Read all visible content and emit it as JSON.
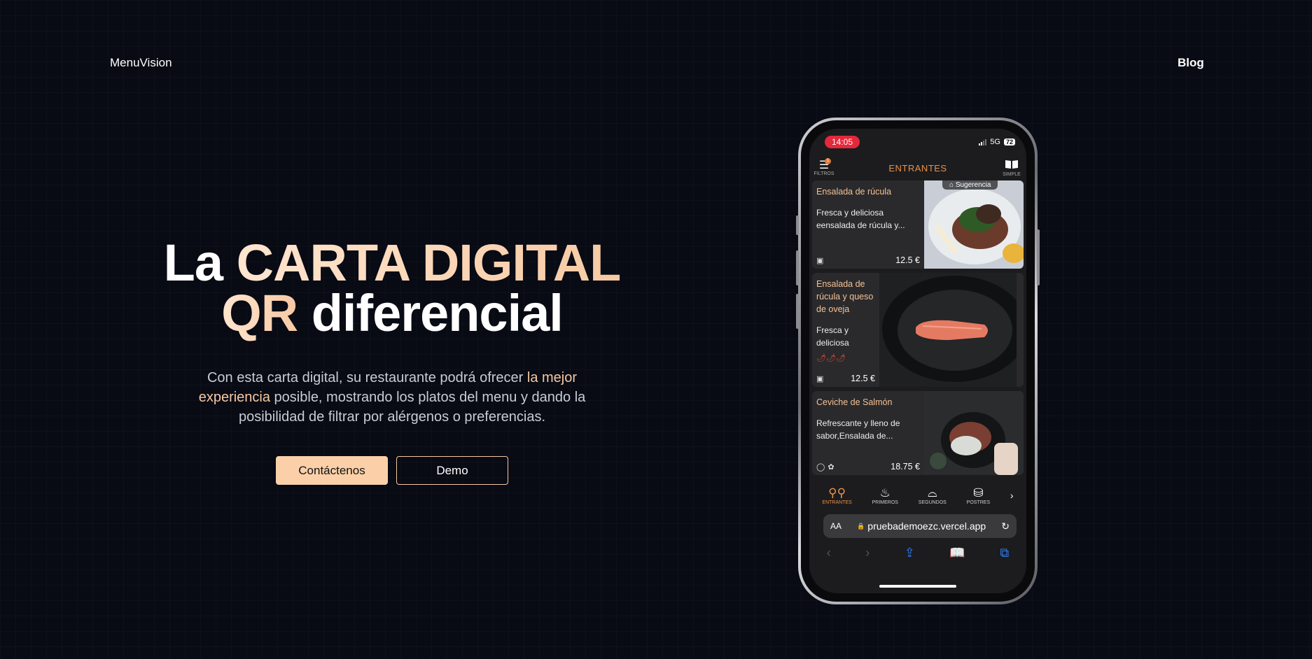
{
  "nav": {
    "brand": "MenuVision",
    "blog": "Blog"
  },
  "hero": {
    "title_1": "La ",
    "title_accent_1": "CARTA DIGITAL",
    "title_accent_2": "QR",
    "title_2": " diferencial",
    "desc_1": "Con esta carta digital, su restaurante podrá ofrecer ",
    "desc_hl": "la mejor experiencia",
    "desc_2": " posible, mostrando los platos del menu y dando la posibilidad de filtrar por alérgenos o preferencias.",
    "primary_button": "Contáctenos",
    "secondary_button": "Demo"
  },
  "phone": {
    "time": "14:05",
    "network": "5G",
    "battery": "72",
    "filters_label": "FILTROS",
    "filters_badge": "1",
    "section_title": "ENTRANTES",
    "simple_label": "SIMPLE",
    "dishes": [
      {
        "name": "Ensalada de rúcula",
        "desc": "Fresca y deliciosa eensalada de rúcula y...",
        "price": "12.5 €",
        "badge": "Sugerencia"
      },
      {
        "name": "Ensalada de rúcula y queso de oveja",
        "desc": "Fresca y deliciosa",
        "price": "12.5 €"
      },
      {
        "name": "Ceviche de Salmón",
        "desc": "Refrescante y lleno de sabor,Ensalada de...",
        "price": "18.75 €"
      }
    ],
    "categories": [
      "ENTRANTES",
      "PRIMEROS",
      "SEGUNDOS",
      "POSTRES"
    ],
    "url": "pruebademoezc.vercel.app",
    "aa": "AA"
  },
  "colors": {
    "accent": "#fbd0a8",
    "phone_accent": "#e8924a",
    "background": "#080a14"
  }
}
